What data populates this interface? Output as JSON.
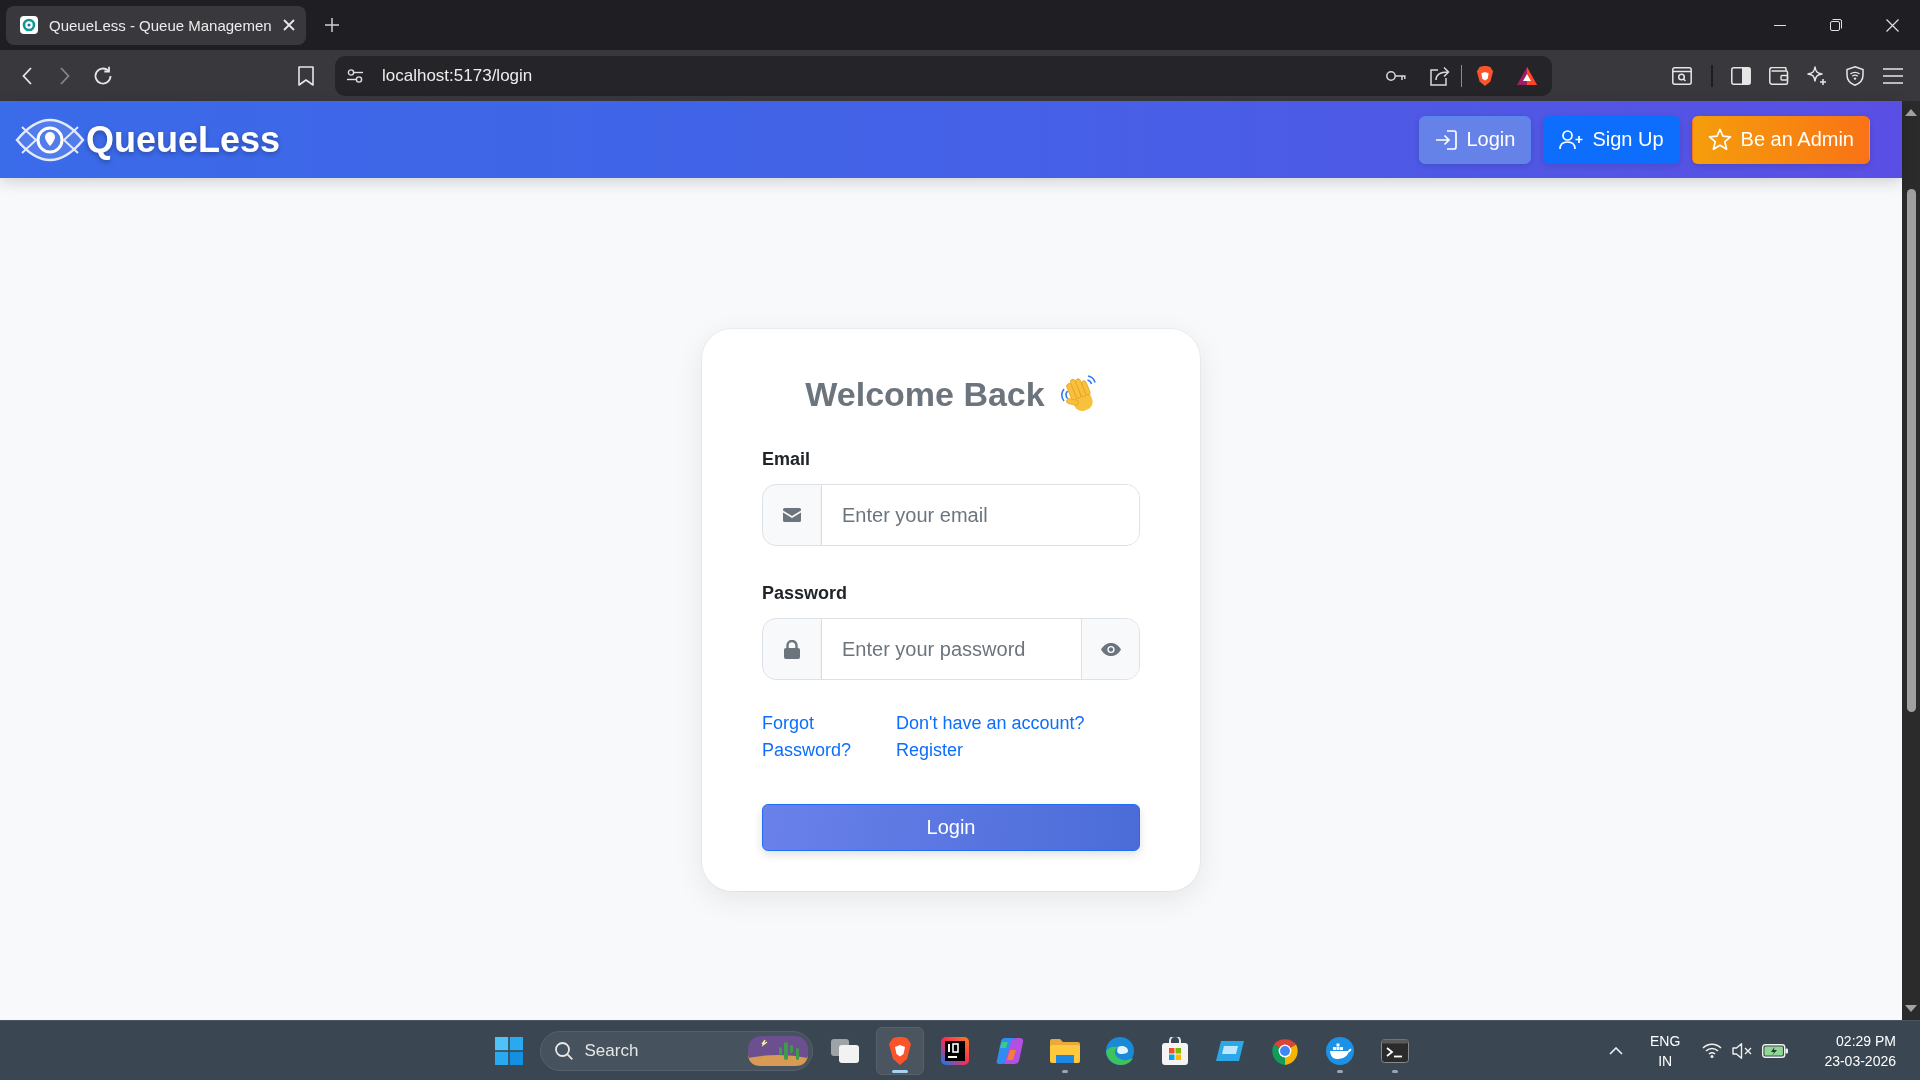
{
  "browser": {
    "tabs": [
      {
        "title": "QueueLess - Queue Managemen",
        "selected": true
      }
    ],
    "address": "localhost:5173/login"
  },
  "header": {
    "brand": "QueueLess",
    "buttons": [
      {
        "label": "Login",
        "kind": "login"
      },
      {
        "label": "Sign Up",
        "kind": "signup"
      },
      {
        "label": "Be an Admin",
        "kind": "admin"
      }
    ]
  },
  "login_card": {
    "title": "Welcome Back",
    "fields": [
      {
        "kind": "email",
        "label": "Email",
        "placeholder": "Enter your email"
      },
      {
        "kind": "password",
        "label": "Password",
        "placeholder": "Enter your password"
      }
    ],
    "links": [
      "Forgot Password?",
      "Don't have an account? Register"
    ],
    "submit": "Login"
  },
  "taskbar": {
    "search_label": "Search",
    "apps": [
      {
        "kind": "taskview",
        "running": false,
        "selected": false
      },
      {
        "kind": "lion",
        "running": true,
        "selected": true
      },
      {
        "kind": "editor",
        "running": false,
        "selected": false
      },
      {
        "kind": "swirl",
        "running": false,
        "selected": false
      },
      {
        "kind": "folder",
        "running": true,
        "selected": false
      },
      {
        "kind": "wave",
        "running": false,
        "selected": false
      },
      {
        "kind": "bag",
        "running": false,
        "selected": false
      },
      {
        "kind": "panel",
        "running": false,
        "selected": false
      },
      {
        "kind": "wheel",
        "running": false,
        "selected": false
      },
      {
        "kind": "whale",
        "running": true,
        "selected": false
      },
      {
        "kind": "terminal",
        "running": true,
        "selected": false
      }
    ],
    "tray": {
      "language": "ENG",
      "region": "IN",
      "time": "02:29 PM",
      "date": "23-03-2026"
    }
  }
}
